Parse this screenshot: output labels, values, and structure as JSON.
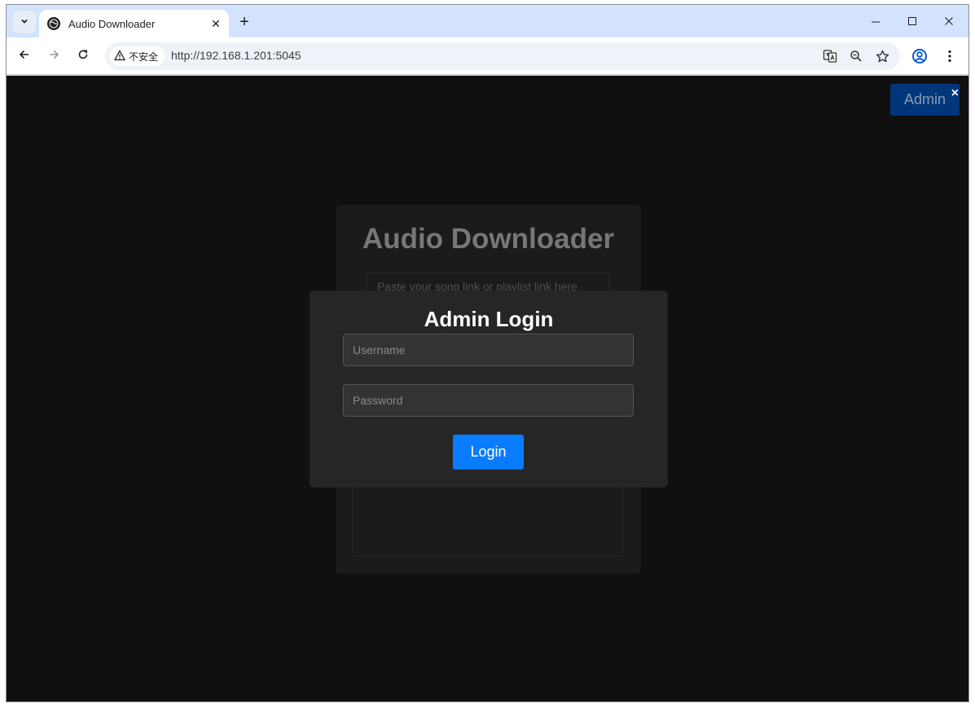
{
  "browser": {
    "tab": {
      "title": "Audio Downloader",
      "close_glyph": "✕"
    },
    "new_tab_glyph": "+",
    "window_controls": {
      "minimize": "–",
      "maximize": "☐",
      "close": "✕"
    },
    "security_label": "不安全",
    "url": "http://192.168.1.201:5045",
    "icons": [
      "tab-list-icon",
      "globe-icon",
      "back-arrow-icon",
      "forward-arrow-icon",
      "reload-icon",
      "warning-icon",
      "translate-icon",
      "zoom-icon",
      "star-icon",
      "profile-icon",
      "kebab-menu-icon"
    ]
  },
  "page": {
    "admin_button": {
      "label": "Admin",
      "close_glyph": "×"
    },
    "card": {
      "title": "Audio Downloader",
      "link_input_placeholder": "Paste your song link or playlist link here"
    },
    "modal": {
      "title": "Admin Login",
      "username_placeholder": "Username",
      "password_placeholder": "Password",
      "login_label": "Login"
    }
  },
  "colors": {
    "page_background": "#101010",
    "modal_background": "#262626",
    "login_button": "#0a7cff",
    "admin_button": "#01367a"
  }
}
